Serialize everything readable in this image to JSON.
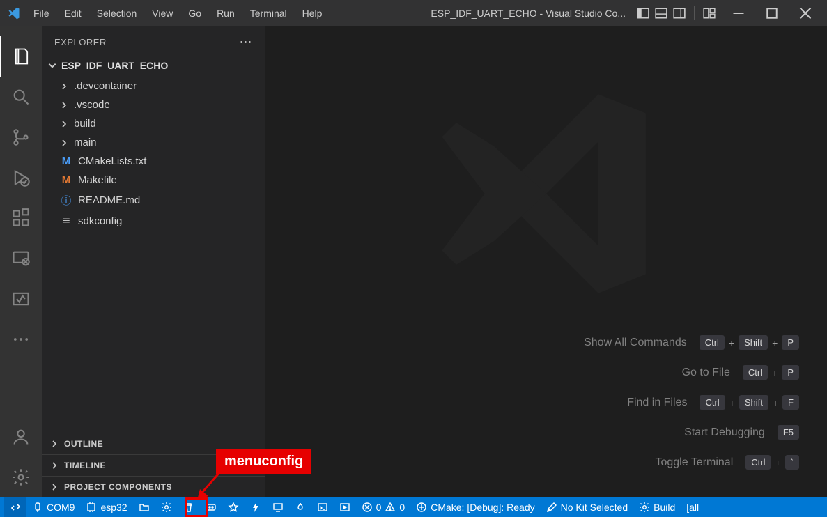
{
  "title": "ESP_IDF_UART_ECHO - Visual Studio Co...",
  "menu": [
    "File",
    "Edit",
    "Selection",
    "View",
    "Go",
    "Run",
    "Terminal",
    "Help"
  ],
  "sidebar": {
    "header": "EXPLORER",
    "project": "ESP_IDF_UART_ECHO",
    "folders": [
      ".devcontainer",
      ".vscode",
      "build",
      "main"
    ],
    "files": [
      {
        "icon": "M",
        "cls": "blue",
        "name": "CMakeLists.txt"
      },
      {
        "icon": "M",
        "cls": "orange",
        "name": "Makefile"
      },
      {
        "icon": "ⓘ",
        "cls": "info",
        "name": "README.md"
      },
      {
        "icon": "≣",
        "cls": "gray",
        "name": "sdkconfig"
      }
    ],
    "sections": [
      "OUTLINE",
      "TIMELINE",
      "PROJECT COMPONENTS"
    ]
  },
  "shortcuts": [
    {
      "label": "Show All Commands",
      "keys": [
        "Ctrl",
        "Shift",
        "P"
      ]
    },
    {
      "label": "Go to File",
      "keys": [
        "Ctrl",
        "P"
      ]
    },
    {
      "label": "Find in Files",
      "keys": [
        "Ctrl",
        "Shift",
        "F"
      ]
    },
    {
      "label": "Start Debugging",
      "keys": [
        "F5"
      ]
    },
    {
      "label": "Toggle Terminal",
      "keys": [
        "Ctrl",
        "`"
      ]
    }
  ],
  "status": {
    "port": "COM9",
    "target": "esp32",
    "errwarn0": "0",
    "errwarn1": "0",
    "cmake": "CMake: [Debug]: Ready",
    "kit": "No Kit Selected",
    "build": "Build",
    "all": "[all"
  },
  "annotation": "menuconfig"
}
